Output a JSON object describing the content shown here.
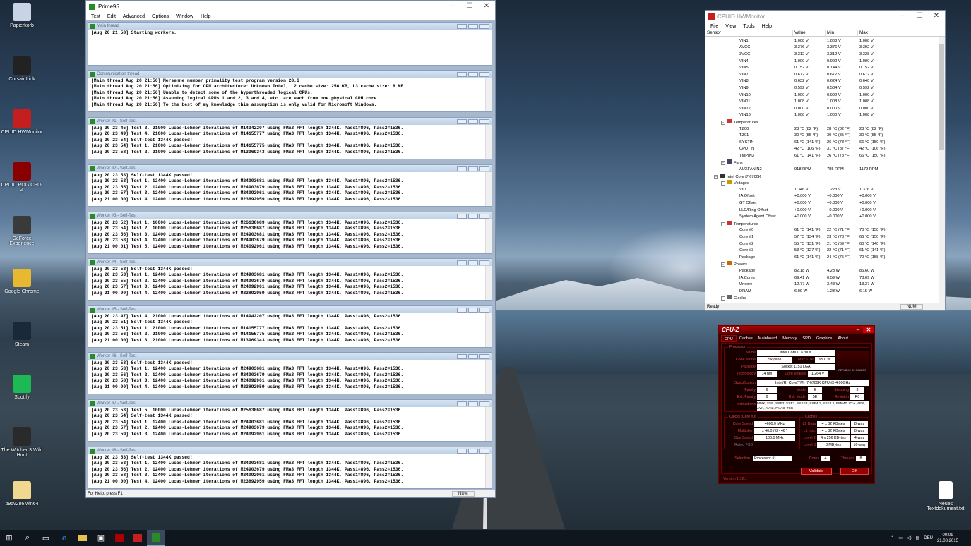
{
  "desktop": {
    "icons": [
      {
        "label": "Papierkorb",
        "color": "#c8d4e4"
      },
      {
        "label": "Corsair Link",
        "color": "#222"
      },
      {
        "label": "CPUID HWMonitor",
        "color": "#c41e1e"
      },
      {
        "label": "CPUID ROG CPU-Z",
        "color": "#8a0000"
      },
      {
        "label": "GeForce Experience",
        "color": "#3a3a3a"
      },
      {
        "label": "Google Chrome",
        "color": "#e8b830"
      },
      {
        "label": "Steam",
        "color": "#1b2838"
      },
      {
        "label": "Spotify",
        "color": "#1db954"
      },
      {
        "label": "The Witcher 3 Wild Hunt",
        "color": "#2a2a2a"
      },
      {
        "label": "p95v286.win64",
        "color": "#f0d890"
      }
    ],
    "right_icon": {
      "label": "Neues Textdokument.txt",
      "color": "#ffffff"
    }
  },
  "prime95": {
    "title": "Prime95",
    "menu": [
      "Test",
      "Edit",
      "Advanced",
      "Options",
      "Window",
      "Help"
    ],
    "status": "For Help, press F1",
    "status_num": "NUM",
    "panes": [
      {
        "title": "Main thread",
        "lines": [
          "[Aug 20 21:58] Starting workers."
        ]
      },
      {
        "title": "Communication thread",
        "lines": [
          "[Main thread Aug 20 21:56] Mersenne number primality test program version 28.6",
          "[Main thread Aug 20 21:56] Optimizing for CPU architecture: Unknown Intel, L2 cache size: 256 KB, L3 cache size: 8 MB",
          "[Main thread Aug 20 21:56] Unable to detect some of the hyperthreaded logical CPUs.",
          "[Main thread Aug 20 21:56] Assuming logical CPUs 1 and 2, 3 and 4, etc. are each from one physical CPU core.",
          "[Main thread Aug 20 21:56] To the best of my knowledge this assumption is only valid for Microsoft Windows."
        ]
      },
      {
        "title": "Worker #1 - Self-Test",
        "lines": [
          "[Aug 20 23:45] Test 3, 21000 Lucas-Lehmer iterations of M14942207 using FMA3 FFT length 1344K, Pass1=896, Pass2=1536.",
          "[Aug 20 23:49] Test 4, 21000 Lucas-Lehmer iterations of M14155777 using FMA3 FFT length 1344K, Pass1=896, Pass2=1536.",
          "[Aug 20 23:54] Self-test 1344K passed!",
          "[Aug 20 23:54] Test 1, 21000 Lucas-Lehmer iterations of M14155775 using FMA3 FFT length 1344K, Pass1=896, Pass2=1536.",
          "[Aug 20 23:58] Test 2, 21000 Lucas-Lehmer iterations of M13969343 using FMA3 FFT length 1344K, Pass1=896, Pass2=1536."
        ]
      },
      {
        "title": "Worker #2 - Self-Test",
        "lines": [
          "[Aug 20 23:53] Self-test 1344K passed!",
          "[Aug 20 23:53] Test 1, 12400 Lucas-Lehmer iterations of M24903681 using FMA3 FFT length 1344K, Pass1=896, Pass2=1536.",
          "[Aug 20 23:55] Test 2, 12400 Lucas-Lehmer iterations of M24903679 using FMA3 FFT length 1344K, Pass1=896, Pass2=1536.",
          "[Aug 20 23:57] Test 3, 12400 Lucas-Lehmer iterations of M24092961 using FMA3 FFT length 1344K, Pass1=896, Pass2=1536.",
          "[Aug 21 00:00] Test 4, 12400 Lucas-Lehmer iterations of M23892959 using FMA3 FFT length 1344K, Pass1=896, Pass2=1536."
        ]
      },
      {
        "title": "Worker #3 - Self-Test",
        "lines": [
          "[Aug 20 23:52] Test 1, 10000 Lucas-Lehmer iterations of M26138689 using FMA3 FFT length 1344K, Pass1=896, Pass2=1536.",
          "[Aug 20 23:54] Test 2, 10000 Lucas-Lehmer iterations of M25638687 using FMA3 FFT length 1344K, Pass1=896, Pass2=1536.",
          "[Aug 20 23:56] Test 3, 12400 Lucas-Lehmer iterations of M24903681 using FMA3 FFT length 1344K, Pass1=896, Pass2=1536.",
          "[Aug 20 23:58] Test 4, 12400 Lucas-Lehmer iterations of M24903679 using FMA3 FFT length 1344K, Pass1=896, Pass2=1536.",
          "[Aug 21 00:01] Test 5, 12400 Lucas-Lehmer iterations of M24092961 using FMA3 FFT length 1344K, Pass1=896, Pass2=1536."
        ]
      },
      {
        "title": "Worker #4 - Self-Test",
        "lines": [
          "[Aug 20 23:53] Self-test 1344K passed!",
          "[Aug 20 23:53] Test 1, 12400 Lucas-Lehmer iterations of M24903681 using FMA3 FFT length 1344K, Pass1=896, Pass2=1536.",
          "[Aug 20 23:55] Test 2, 12400 Lucas-Lehmer iterations of M24903679 using FMA3 FFT length 1344K, Pass1=896, Pass2=1536.",
          "[Aug 20 23:57] Test 3, 12400 Lucas-Lehmer iterations of M24092961 using FMA3 FFT length 1344K, Pass1=896, Pass2=1536.",
          "[Aug 21 00:00] Test 4, 12400 Lucas-Lehmer iterations of M23892959 using FMA3 FFT length 1344K, Pass1=896, Pass2=1536."
        ]
      },
      {
        "title": "Worker #5 - Self-Test",
        "lines": [
          "[Aug 20 23:47] Test 4, 21000 Lucas-Lehmer iterations of M14942207 using FMA3 FFT length 1344K, Pass1=896, Pass2=1536.",
          "[Aug 20 23:51] Self-test 1344K passed!",
          "[Aug 20 23:51] Test 1, 21000 Lucas-Lehmer iterations of M14155777 using FMA3 FFT length 1344K, Pass1=896, Pass2=1536.",
          "[Aug 20 23:56] Test 2, 21000 Lucas-Lehmer iterations of M14155775 using FMA3 FFT length 1344K, Pass1=896, Pass2=1536.",
          "[Aug 21 00:00] Test 3, 21000 Lucas-Lehmer iterations of M13969343 using FMA3 FFT length 1344K, Pass1=896, Pass2=1536."
        ]
      },
      {
        "title": "Worker #6 - Self-Test",
        "lines": [
          "[Aug 20 23:53] Self-test 1344K passed!",
          "[Aug 20 23:53] Test 1, 12400 Lucas-Lehmer iterations of M24903681 using FMA3 FFT length 1344K, Pass1=896, Pass2=1536.",
          "[Aug 20 23:56] Test 2, 12400 Lucas-Lehmer iterations of M24903679 using FMA3 FFT length 1344K, Pass1=896, Pass2=1536.",
          "[Aug 20 23:58] Test 3, 12400 Lucas-Lehmer iterations of M24092961 using FMA3 FFT length 1344K, Pass1=896, Pass2=1536.",
          "[Aug 21 00:00] Test 4, 12400 Lucas-Lehmer iterations of M23892959 using FMA3 FFT length 1344K, Pass1=896, Pass2=1536."
        ]
      },
      {
        "title": "Worker #7 - Self-Test",
        "lines": [
          "[Aug 20 23:53] Test 5, 10000 Lucas-Lehmer iterations of M25638687 using FMA3 FFT length 1344K, Pass1=896, Pass2=1536.",
          "[Aug 20 23:54] Self-test 1344K passed!",
          "[Aug 20 23:54] Test 1, 12400 Lucas-Lehmer iterations of M24903681 using FMA3 FFT length 1344K, Pass1=896, Pass2=1536.",
          "[Aug 20 23:57] Test 2, 12400 Lucas-Lehmer iterations of M24903679 using FMA3 FFT length 1344K, Pass1=896, Pass2=1536.",
          "[Aug 20 23:59] Test 3, 12400 Lucas-Lehmer iterations of M24092961 using FMA3 FFT length 1344K, Pass1=896, Pass2=1536."
        ]
      },
      {
        "title": "Worker #8 - Self-Test",
        "lines": [
          "[Aug 20 23:53] Self-test 1344K passed!",
          "[Aug 20 23:53] Test 1, 12400 Lucas-Lehmer iterations of M24903681 using FMA3 FFT length 1344K, Pass1=896, Pass2=1536.",
          "[Aug 20 23:56] Test 2, 12400 Lucas-Lehmer iterations of M24903679 using FMA3 FFT length 1344K, Pass1=896, Pass2=1536.",
          "[Aug 20 23:58] Test 3, 12400 Lucas-Lehmer iterations of M24092961 using FMA3 FFT length 1344K, Pass1=896, Pass2=1536.",
          "[Aug 21 00:00] Test 4, 12400 Lucas-Lehmer iterations of M23892959 using FMA3 FFT length 1344K, Pass1=896, Pass2=1536."
        ]
      }
    ]
  },
  "hwmonitor": {
    "title": "CPUID HWMonitor",
    "menu": [
      "File",
      "View",
      "Tools",
      "Help"
    ],
    "columns": [
      "Sensor",
      "Value",
      "Min",
      "Max"
    ],
    "rows": [
      {
        "n": "VIN1",
        "v": "1.008 V",
        "mi": "1.008 V",
        "ma": "1.008 V",
        "lvl": 3
      },
      {
        "n": "AVCC",
        "v": "3.376 V",
        "mi": "3.376 V",
        "ma": "3.392 V",
        "lvl": 3
      },
      {
        "n": "3VCC",
        "v": "3.312 V",
        "mi": "3.312 V",
        "ma": "3.328 V",
        "lvl": 3
      },
      {
        "n": "VIN4",
        "v": "1.000 V",
        "mi": "0.992 V",
        "ma": "1.000 V",
        "lvl": 3
      },
      {
        "n": "VIN5",
        "v": "0.152 V",
        "mi": "0.144 V",
        "ma": "0.152 V",
        "lvl": 3
      },
      {
        "n": "VIN7",
        "v": "0.672 V",
        "mi": "0.672 V",
        "ma": "0.672 V",
        "lvl": 3
      },
      {
        "n": "VIN8",
        "v": "0.632 V",
        "mi": "0.624 V",
        "ma": "0.640 V",
        "lvl": 3
      },
      {
        "n": "VIN9",
        "v": "0.592 V",
        "mi": "0.584 V",
        "ma": "0.592 V",
        "lvl": 3
      },
      {
        "n": "VIN10",
        "v": "1.000 V",
        "mi": "0.992 V",
        "ma": "1.000 V",
        "lvl": 3
      },
      {
        "n": "VIN11",
        "v": "1.008 V",
        "mi": "1.008 V",
        "ma": "1.008 V",
        "lvl": 3
      },
      {
        "n": "VIN12",
        "v": "0.000 V",
        "mi": "0.000 V",
        "ma": "0.000 V",
        "lvl": 3
      },
      {
        "n": "VIN13",
        "v": "1.008 V",
        "mi": "1.000 V",
        "ma": "1.008 V",
        "lvl": 3
      },
      {
        "n": "Temperatures",
        "v": "",
        "mi": "",
        "ma": "",
        "lvl": 2,
        "g": true,
        "ic": "#c33"
      },
      {
        "n": "TZ00",
        "v": "28 °C  (82 °F)",
        "mi": "28 °C  (82 °F)",
        "ma": "28 °C  (82 °F)",
        "lvl": 3
      },
      {
        "n": "TZ01",
        "v": "30 °C  (85 °F)",
        "mi": "30 °C  (85 °F)",
        "ma": "30 °C  (85 °F)",
        "lvl": 3
      },
      {
        "n": "SYSTIN",
        "v": "61 °C  (141 °F)",
        "mi": "26 °C  (78 °F)",
        "ma": "66 °C  (150 °F)",
        "lvl": 3
      },
      {
        "n": "CPUTIN",
        "v": "42 °C  (106 °F)",
        "mi": "31 °C  (87 °F)",
        "ma": "42 °C  (106 °F)",
        "lvl": 3
      },
      {
        "n": "TMPIN3",
        "v": "61 °C  (141 °F)",
        "mi": "26 °C  (78 °F)",
        "ma": "66 °C  (150 °F)",
        "lvl": 3
      },
      {
        "n": "Fans",
        "v": "",
        "mi": "",
        "ma": "",
        "lvl": 2,
        "g": true,
        "ic": "#446"
      },
      {
        "n": "AUXFANIN2",
        "v": "918 RPM",
        "mi": "785 RPM",
        "ma": "1179 RPM",
        "lvl": 3
      },
      {
        "n": "Intel Core i7 6700K",
        "v": "",
        "mi": "",
        "ma": "",
        "lvl": 1,
        "g": true,
        "ic": "#333"
      },
      {
        "n": "Voltages",
        "v": "",
        "mi": "",
        "ma": "",
        "lvl": 2,
        "g": true,
        "ic": "#c90"
      },
      {
        "n": "VID",
        "v": "1.346 V",
        "mi": "1.223 V",
        "ma": "1.376 V",
        "lvl": 3
      },
      {
        "n": "IA Offset",
        "v": "+0.000 V",
        "mi": "+0.000 V",
        "ma": "+0.000 V",
        "lvl": 3
      },
      {
        "n": "GT Offset",
        "v": "+0.000 V",
        "mi": "+0.000 V",
        "ma": "+0.000 V",
        "lvl": 3
      },
      {
        "n": "LLC/Ring Offset",
        "v": "+0.000 V",
        "mi": "+0.000 V",
        "ma": "+0.000 V",
        "lvl": 3
      },
      {
        "n": "System Agent Offset",
        "v": "+0.000 V",
        "mi": "+0.000 V",
        "ma": "+0.000 V",
        "lvl": 3
      },
      {
        "n": "Temperatures",
        "v": "",
        "mi": "",
        "ma": "",
        "lvl": 2,
        "g": true,
        "ic": "#c33"
      },
      {
        "n": "Core #0",
        "v": "61 °C  (141 °F)",
        "mi": "22 °C  (71 °F)",
        "ma": "70 °C  (158 °F)",
        "lvl": 3
      },
      {
        "n": "Core #1",
        "v": "57 °C  (134 °F)",
        "mi": "23 °C  (73 °F)",
        "ma": "66 °C  (150 °F)",
        "lvl": 3
      },
      {
        "n": "Core #2",
        "v": "55 °C  (131 °F)",
        "mi": "21 °C  (69 °F)",
        "ma": "60 °C  (140 °F)",
        "lvl": 3
      },
      {
        "n": "Core #3",
        "v": "53 °C  (127 °F)",
        "mi": "22 °C  (71 °F)",
        "ma": "61 °C  (141 °F)",
        "lvl": 3
      },
      {
        "n": "Package",
        "v": "61 °C  (141 °F)",
        "mi": "24 °C  (75 °F)",
        "ma": "70 °C  (158 °F)",
        "lvl": 3
      },
      {
        "n": "Powers",
        "v": "",
        "mi": "",
        "ma": "",
        "lvl": 2,
        "g": true,
        "ic": "#c60"
      },
      {
        "n": "Package",
        "v": "82.18 W",
        "mi": "4.23 W",
        "ma": "86.60 W",
        "lvl": 3
      },
      {
        "n": "IA Cores",
        "v": "69.41 W",
        "mi": "0.59 W",
        "ma": "73.69 W",
        "lvl": 3
      },
      {
        "n": "Uncore",
        "v": "12.77 W",
        "mi": "3.48 W",
        "ma": "13.37 W",
        "lvl": 3
      },
      {
        "n": "DRAM",
        "v": "6.09 W",
        "mi": "1.23 W",
        "ma": "6.15 W",
        "lvl": 3
      },
      {
        "n": "Clocks",
        "v": "",
        "mi": "",
        "ma": "",
        "lvl": 2,
        "g": true,
        "ic": "#666"
      }
    ],
    "status": "Ready",
    "status_num": "NUM"
  },
  "cpuz": {
    "title": "CPU-Z",
    "tabs": [
      "CPU",
      "Caches",
      "Mainboard",
      "Memory",
      "SPD",
      "Graphics",
      "About"
    ],
    "processor_legend": "Processor",
    "name_label": "Name",
    "name": "Intel Core i7 6700K",
    "codename_label": "Code Name",
    "codename": "Skylake",
    "maxtdp_label": "Max TDP",
    "maxtdp": "95.0 W",
    "package_label": "Package",
    "package": "Socket 1151 LGA",
    "tech_label": "Technology",
    "tech": "14 nm",
    "corevolt_label": "Core Voltage",
    "corevolt": "1.264 V",
    "spec_label": "Specification",
    "spec": "Intel(R) Core(TM) i7-6700K CPU @ 4.00GHz",
    "family_label": "Family",
    "family": "6",
    "model_label": "Model",
    "model": "E",
    "stepping_label": "Stepping",
    "stepping": "3",
    "extfamily_label": "Ext. Family",
    "extfamily": "6",
    "extmodel_label": "Ext. Model",
    "extmodel": "5E",
    "revision_label": "Revision",
    "revision": "R0",
    "instr_label": "Instructions",
    "instr": "MMX, SSE, SSE2, SSE3, SSSE3, SSE4.1, SSE4.2, EM64T, VT-x, AES, AVX, AVX2, FMA3, TSX",
    "clocks_legend": "Clocks (Core #0)",
    "corespeed_label": "Core Speed",
    "corespeed": "4600.0 MHz",
    "mult_label": "Multiplier",
    "mult": "x 46.0 ( 8 - 46 )",
    "bus_label": "Bus Speed",
    "bus": "100.0 MHz",
    "fsb_label": "Rated FSB",
    "caches_legend": "Caches",
    "l1d_label": "L1 Data",
    "l1d": "4 x 32 KBytes",
    "l1d_w": "8-way",
    "l1i_label": "L1 Inst.",
    "l1i": "4 x 32 KBytes",
    "l1i_w": "8-way",
    "l2_label": "Level 2",
    "l2": "4 x 256 KBytes",
    "l2_w": "4-way",
    "l3_label": "Level 3",
    "l3": "8 MBytes",
    "l3_w": "16-way",
    "selection_label": "Selection",
    "selection": "Processor #1",
    "cores_label": "Cores",
    "cores": "4",
    "threads_label": "Threads",
    "threads": "8",
    "validate": "Validate",
    "ok": "OK",
    "version": "Version 1.72.1",
    "logo": "REPUBLIC OF GAMERS"
  },
  "taskbar": {
    "lang": "DEU",
    "time": "00:01",
    "date": "21.08.2015"
  }
}
